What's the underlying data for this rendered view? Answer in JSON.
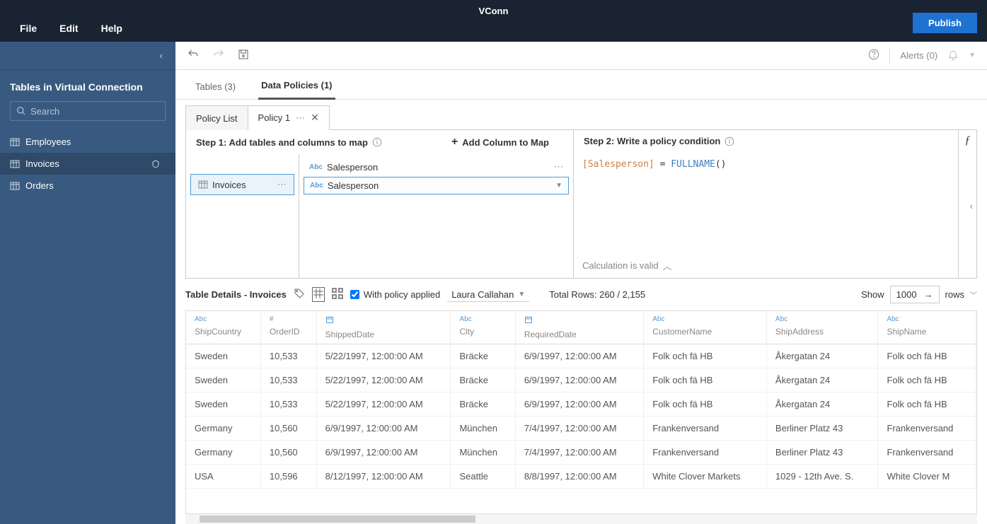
{
  "app": {
    "title": "VConn"
  },
  "menu": {
    "file": "File",
    "edit": "Edit",
    "help": "Help"
  },
  "buttons": {
    "publish": "Publish"
  },
  "toolbar": {
    "alerts": "Alerts (0)"
  },
  "sidebar": {
    "title": "Tables in Virtual Connection",
    "search_placeholder": "Search",
    "tables": [
      "Employees",
      "Invoices",
      "Orders"
    ]
  },
  "tabs": {
    "tables": "Tables (3)",
    "policies": "Data Policies (1)"
  },
  "policy_tabs": {
    "list": "Policy List",
    "policy1": "Policy 1"
  },
  "step1": {
    "header": "Step 1: Add tables and columns to map",
    "add_col": "Add Column to Map",
    "table": "Invoices",
    "col_label": "Salesperson",
    "col_selected": "Salesperson"
  },
  "step2": {
    "header": "Step 2: Write a policy condition",
    "formula_field": "[Salesperson]",
    "formula_eq": " = ",
    "formula_func": "FULLNAME",
    "valid": "Calculation is valid"
  },
  "details": {
    "title": "Table Details - Invoices",
    "with_policy": "With policy applied",
    "user": "Laura Callahan",
    "total": "Total Rows: 260 / 2,155",
    "show": "Show",
    "rows_n": "1000",
    "rows_label": "rows"
  },
  "table": {
    "columns": [
      {
        "type": "Abc",
        "name": "ShipCountry"
      },
      {
        "type": "#",
        "name": "OrderID"
      },
      {
        "type": "date",
        "name": "ShippedDate"
      },
      {
        "type": "Abc",
        "name": "City"
      },
      {
        "type": "date",
        "name": "RequiredDate"
      },
      {
        "type": "Abc",
        "name": "CustomerName"
      },
      {
        "type": "Abc",
        "name": "ShipAddress"
      },
      {
        "type": "Abc",
        "name": "ShipName"
      }
    ],
    "rows": [
      [
        "Sweden",
        "10,533",
        "5/22/1997, 12:00:00 AM",
        "Bräcke",
        "6/9/1997, 12:00:00 AM",
        "Folk och fä HB",
        "Åkergatan 24",
        "Folk och fä HB"
      ],
      [
        "Sweden",
        "10,533",
        "5/22/1997, 12:00:00 AM",
        "Bräcke",
        "6/9/1997, 12:00:00 AM",
        "Folk och fä HB",
        "Åkergatan 24",
        "Folk och fä HB"
      ],
      [
        "Sweden",
        "10,533",
        "5/22/1997, 12:00:00 AM",
        "Bräcke",
        "6/9/1997, 12:00:00 AM",
        "Folk och fä HB",
        "Åkergatan 24",
        "Folk och fä HB"
      ],
      [
        "Germany",
        "10,560",
        "6/9/1997, 12:00:00 AM",
        "München",
        "7/4/1997, 12:00:00 AM",
        "Frankenversand",
        "Berliner Platz 43",
        "Frankenversand"
      ],
      [
        "Germany",
        "10,560",
        "6/9/1997, 12:00:00 AM",
        "München",
        "7/4/1997, 12:00:00 AM",
        "Frankenversand",
        "Berliner Platz 43",
        "Frankenversand"
      ],
      [
        "USA",
        "10,596",
        "8/12/1997, 12:00:00 AM",
        "Seattle",
        "8/8/1997, 12:00:00 AM",
        "White Clover Markets",
        "1029 - 12th Ave. S.",
        "White Clover M"
      ]
    ]
  }
}
